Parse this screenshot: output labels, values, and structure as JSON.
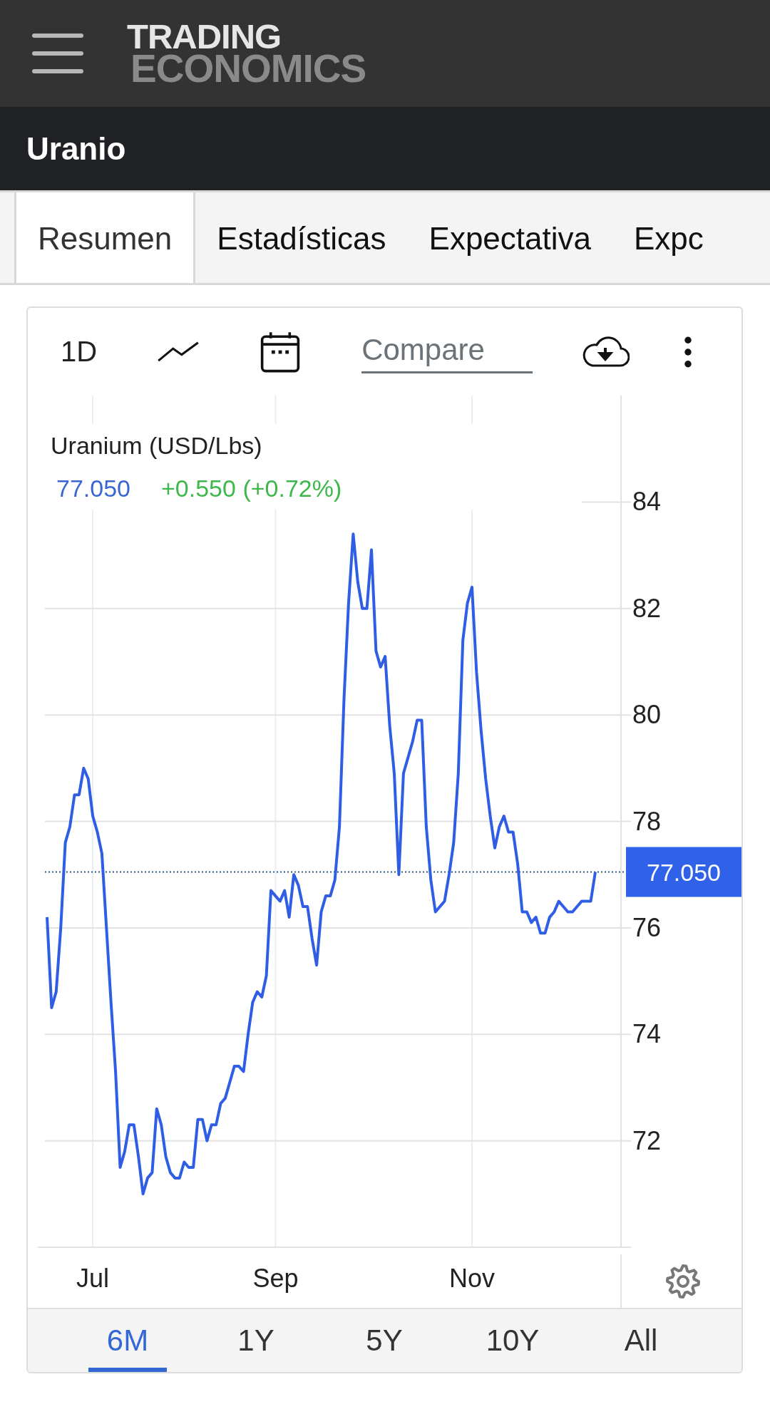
{
  "header": {
    "logo": {
      "line_1": "TRADING",
      "line_2": "ECONOMICS"
    }
  },
  "page_title": "Uranio",
  "tabs": [
    {
      "label": "Resumen",
      "selected": true
    },
    {
      "label": "Estadísticas",
      "selected": false
    },
    {
      "label": "Expectativa",
      "selected": false
    },
    {
      "label": "Expc",
      "selected": false
    }
  ],
  "toolbar": {
    "interval": "1D",
    "compare": {
      "placeholder": "Compare"
    }
  },
  "chart": {
    "legend": {
      "price": "77.050",
      "change": "+0.550 (+0.72%)"
    },
    "chart_data": {
      "type": "line",
      "title": "Uranium (USD/Lbs)",
      "ylim": [
        70,
        86
      ],
      "grid": true,
      "ref_lines": [
        {
          "axis": "y",
          "value": 77.05,
          "label": "77.050"
        }
      ],
      "yticks": [
        72,
        74,
        76,
        78,
        80,
        82,
        84
      ],
      "categories": [
        null,
        null,
        null,
        null,
        null,
        null,
        null,
        null,
        null,
        null,
        "Jul",
        null,
        null,
        null,
        null,
        null,
        null,
        null,
        null,
        null,
        null,
        null,
        null,
        null,
        null,
        null,
        null,
        null,
        null,
        null,
        null,
        null,
        null,
        null,
        null,
        null,
        null,
        null,
        null,
        null,
        null,
        null,
        null,
        null,
        null,
        null,
        null,
        null,
        null,
        null,
        "Sep",
        null,
        null,
        null,
        null,
        null,
        null,
        null,
        null,
        null,
        null,
        null,
        null,
        null,
        null,
        null,
        null,
        null,
        null,
        null,
        null,
        null,
        null,
        null,
        null,
        null,
        null,
        null,
        null,
        null,
        null,
        null,
        null,
        null,
        null,
        null,
        null,
        null,
        null,
        null,
        null,
        null,
        null,
        "Nov",
        null,
        null,
        null,
        null,
        null,
        null,
        null,
        null,
        null,
        null,
        null,
        null,
        null,
        null,
        null,
        null,
        null,
        null,
        null,
        null,
        null,
        null,
        null,
        null,
        null,
        null,
        null
      ],
      "series": [
        {
          "color": "#2f5ee5",
          "values": [
            76.2,
            74.5,
            74.8,
            76.0,
            77.6,
            77.9,
            78.5,
            78.5,
            79.0,
            78.8,
            78.1,
            77.8,
            77.4,
            76.0,
            74.6,
            73.3,
            71.5,
            71.8,
            72.3,
            72.3,
            71.7,
            71.0,
            71.3,
            71.4,
            72.6,
            72.3,
            71.7,
            71.4,
            71.3,
            71.3,
            71.6,
            71.5,
            71.5,
            72.4,
            72.4,
            72.0,
            72.3,
            72.3,
            72.7,
            72.8,
            73.1,
            73.4,
            73.4,
            73.3,
            74.0,
            74.6,
            74.8,
            74.7,
            75.1,
            76.7,
            76.6,
            76.5,
            76.7,
            76.2,
            77.0,
            76.8,
            76.4,
            76.4,
            75.8,
            75.3,
            76.3,
            76.6,
            76.6,
            76.9,
            77.9,
            80.3,
            82.1,
            83.4,
            82.5,
            82.0,
            82.0,
            83.1,
            81.2,
            80.9,
            81.1,
            79.8,
            78.9,
            77.0,
            78.9,
            79.2,
            79.5,
            79.9,
            79.9,
            77.9,
            76.9,
            76.3,
            76.4,
            76.5,
            77.0,
            77.6,
            78.9,
            81.4,
            82.1,
            82.4,
            80.8,
            79.7,
            78.8,
            78.1,
            77.5,
            77.9,
            78.1,
            77.8,
            77.8,
            77.2,
            76.3,
            76.3,
            76.1,
            76.2,
            75.9,
            75.9,
            76.2,
            76.3,
            76.5,
            76.4,
            76.3,
            76.3,
            76.4,
            76.5,
            76.5,
            76.5,
            77.05
          ]
        }
      ]
    }
  },
  "periods": [
    {
      "label": "6M",
      "selected": true
    },
    {
      "label": "1Y",
      "selected": false
    },
    {
      "label": "5Y",
      "selected": false
    },
    {
      "label": "10Y",
      "selected": false
    },
    {
      "label": "All",
      "selected": false
    }
  ]
}
